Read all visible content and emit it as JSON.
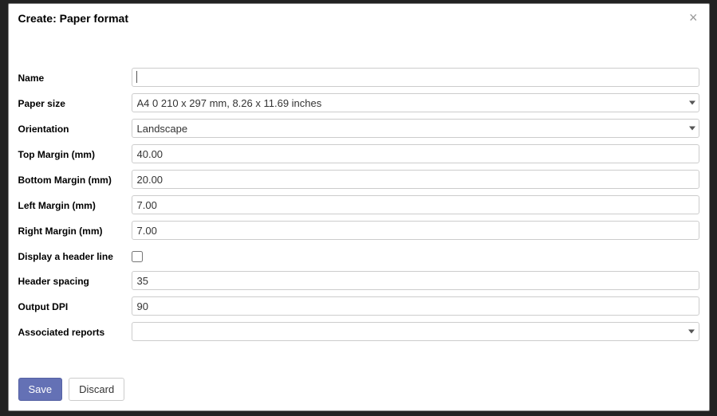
{
  "dialog": {
    "title": "Create: Paper format",
    "close_glyph": "×"
  },
  "fields": {
    "name": {
      "label": "Name",
      "value": ""
    },
    "paper_size": {
      "label": "Paper size",
      "value": "A4 0 210 x 297 mm, 8.26 x 11.69 inches"
    },
    "orientation": {
      "label": "Orientation",
      "value": "Landscape"
    },
    "top_margin": {
      "label": "Top Margin (mm)",
      "value": "40.00"
    },
    "bottom_margin": {
      "label": "Bottom Margin (mm)",
      "value": "20.00"
    },
    "left_margin": {
      "label": "Left Margin (mm)",
      "value": "7.00"
    },
    "right_margin": {
      "label": "Right Margin (mm)",
      "value": "7.00"
    },
    "display_header": {
      "label": "Display a header line",
      "checked": false
    },
    "header_spacing": {
      "label": "Header spacing",
      "value": "35"
    },
    "output_dpi": {
      "label": "Output DPI",
      "value": "90"
    },
    "associated_reports": {
      "label": "Associated reports",
      "value": ""
    }
  },
  "buttons": {
    "save": "Save",
    "discard": "Discard"
  }
}
